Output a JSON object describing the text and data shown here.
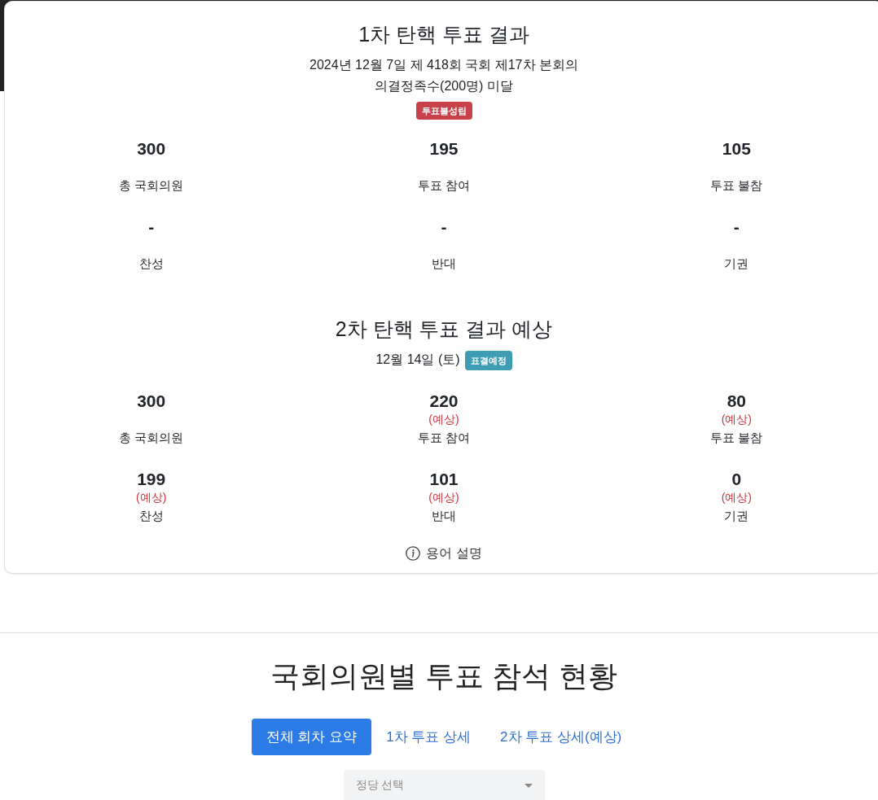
{
  "sections": [
    {
      "title": "1차 탄핵 투표 결과",
      "subtitle_lines": [
        "2024년 12월 7일 제 418회 국회 제17차 본회의",
        "의결정족수(200명) 미달"
      ],
      "badge": {
        "text": "투표불성립",
        "color": "#c8414b",
        "own_line": true
      },
      "stats": [
        {
          "value": "300",
          "caption": "총 국회의원"
        },
        {
          "value": "195",
          "caption": "투표 참여"
        },
        {
          "value": "105",
          "caption": "투표 불참"
        },
        {
          "value": "-",
          "caption": "찬성"
        },
        {
          "value": "-",
          "caption": "반대"
        },
        {
          "value": "-",
          "caption": "기권"
        }
      ]
    },
    {
      "title": "2차 탄핵 투표 결과 예상",
      "subtitle_lines": [
        "12월 14일 (토)"
      ],
      "badge": {
        "text": "표결예정",
        "color": "#3f9db3",
        "own_line": false
      },
      "stats": [
        {
          "value": "300",
          "caption": "총 국회의원"
        },
        {
          "value": "220",
          "note": "(예상)",
          "caption": "투표 참여"
        },
        {
          "value": "80",
          "note": "(예상)",
          "caption": "투표 불참"
        },
        {
          "value": "199",
          "note": "(예상)",
          "caption": "찬성"
        },
        {
          "value": "101",
          "note": "(예상)",
          "caption": "반대"
        },
        {
          "value": "0",
          "note": "(예상)",
          "caption": "기권"
        }
      ]
    }
  ],
  "glossary_link": {
    "label": "용어 설명"
  },
  "attendance": {
    "heading": "국회의원별 투표 참석 현황",
    "tabs": [
      {
        "label": "전체 회차 요약",
        "selected": true
      },
      {
        "label": "1차 투표 상세",
        "selected": false
      },
      {
        "label": "2차 투표 상세(예상)",
        "selected": false
      }
    ],
    "party_select": {
      "placeholder": "정당 선택"
    }
  }
}
